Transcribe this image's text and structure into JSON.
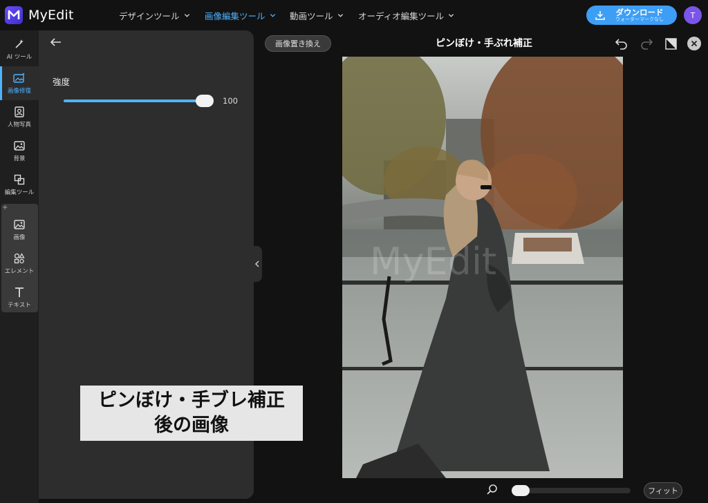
{
  "app": {
    "name": "MyEdit",
    "nav": [
      {
        "label": "デザインツール"
      },
      {
        "label": "画像編集ツール"
      },
      {
        "label": "動画ツール"
      },
      {
        "label": "オーディオ編集ツール"
      }
    ],
    "active_nav": "画像編集ツール",
    "download": {
      "label": "ダウンロード",
      "sublabel": "ウォーターマークなし"
    },
    "avatar_initial": "T",
    "accent_color": "#4fb3ff",
    "download_color": "#3d9ef5"
  },
  "rail": {
    "items": [
      {
        "label": "AI ツール",
        "icon": "magic-wand-icon"
      },
      {
        "label": "画像修復",
        "icon": "image-sparkle-icon"
      },
      {
        "label": "人物写真",
        "icon": "portrait-icon"
      },
      {
        "label": "背景",
        "icon": "background-icon"
      },
      {
        "label": "編集ツール",
        "icon": "crop-icon"
      },
      {
        "label": "画像",
        "icon": "image-icon"
      },
      {
        "label": "エレメント",
        "icon": "shapes-icon"
      },
      {
        "label": "テキスト",
        "icon": "text-icon"
      }
    ],
    "active": "画像修復"
  },
  "panel": {
    "strength_label": "強度",
    "strength_value": "100",
    "strength_fraction": 1.0
  },
  "canvas": {
    "replace_label": "画像置き換え",
    "title": "ピンぼけ・手ぶれ補正",
    "fit_label": "フィット",
    "zoom_fraction": 0.0,
    "watermark": "MyEdit"
  },
  "caption": {
    "line1": "ピンぼけ・手ブレ補正",
    "line2": "後の画像"
  }
}
